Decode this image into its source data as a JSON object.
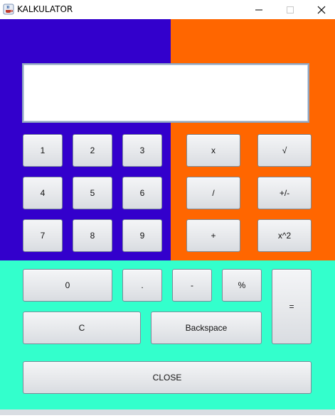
{
  "window": {
    "title": "KALKULATOR",
    "minimize_icon": "minimize-icon",
    "maximize_icon": "maximize-icon",
    "close_icon": "close-icon",
    "app_icon": "java-cup-icon"
  },
  "colors": {
    "left_panel": "#3300cc",
    "right_panel": "#ff6600",
    "bottom_panel": "#33ffcc"
  },
  "display": {
    "value": ""
  },
  "keys": {
    "k1": "1",
    "k2": "2",
    "k3": "3",
    "k4": "4",
    "k5": "5",
    "k6": "6",
    "k7": "7",
    "k8": "8",
    "k9": "9",
    "multiply": "x",
    "sqrt": "√",
    "divide": "/",
    "plus_minus": "+/-",
    "plus": "+",
    "square": "x^2",
    "k0": "0",
    "dot": ".",
    "minus": "-",
    "percent": "%",
    "equals": "=",
    "clear": "C",
    "backspace": "Backspace",
    "close": "CLOSE"
  }
}
